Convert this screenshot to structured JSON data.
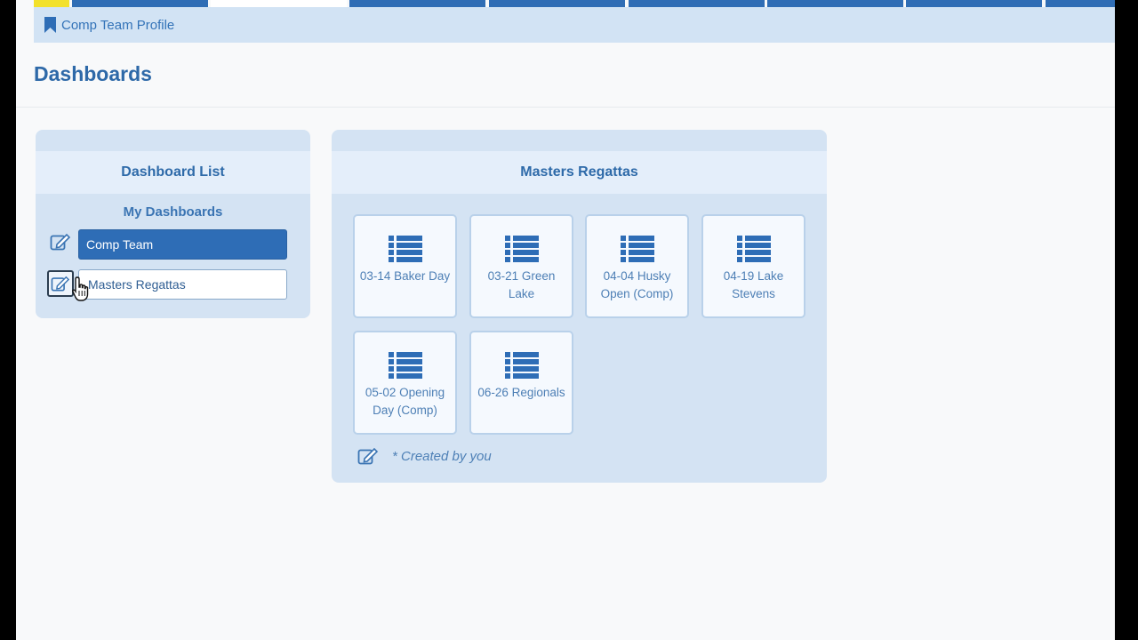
{
  "breadcrumb": {
    "label": "Comp Team Profile"
  },
  "page": {
    "title": "Dashboards"
  },
  "dashboard_list": {
    "title": "Dashboard List",
    "section_title": "My Dashboards",
    "items": [
      {
        "label": "Comp Team",
        "selected": true
      },
      {
        "label": "Masters Regattas",
        "selected": false
      }
    ]
  },
  "selected_dashboard": {
    "title": "Masters Regattas",
    "tiles": [
      {
        "label": "03-14 Baker Day"
      },
      {
        "label": "03-21 Green Lake"
      },
      {
        "label": "04-04 Husky Open (Comp)"
      },
      {
        "label": "04-19 Lake Stevens"
      },
      {
        "label": "05-02 Opening Day (Comp)"
      },
      {
        "label": "06-26 Regionals"
      }
    ],
    "legend": "* Created by you"
  },
  "icons": {
    "breadcrumb": "bookmark-icon",
    "edit": "edit-icon",
    "tile": "list-icon"
  },
  "colors": {
    "accent": "#2e6db6",
    "panel": "#d4e3f3",
    "panel_header": "#e4eefa",
    "breadcrumb_bg": "#d2e3f4",
    "tab_yellow": "#f2e12b"
  }
}
